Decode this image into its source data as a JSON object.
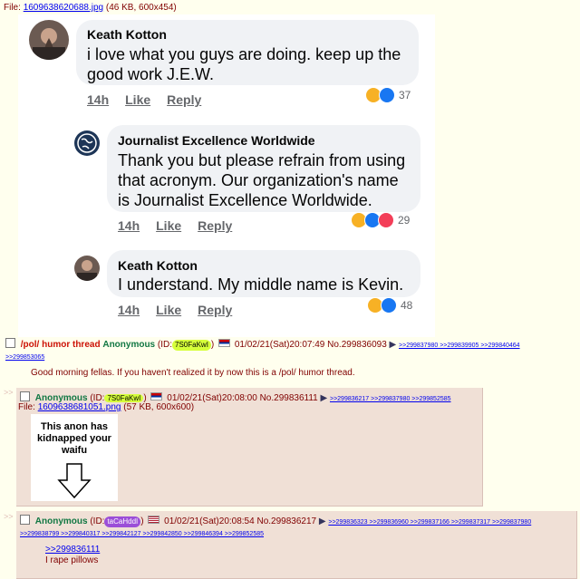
{
  "op": {
    "file_label": "File:",
    "file_name": "1609638620688.jpg",
    "file_meta": "(46 KB, 600x454)",
    "subject": "/pol/ humor thread",
    "name": "Anonymous",
    "id_prefix": "(ID:",
    "id": "7S0FaKwI",
    "id_suffix": ")",
    "date": "01/02/21(Sat)20:07:49",
    "no": "No.299836093",
    "arrow": "▶",
    "backlinks": ">>299837980 >>299839905 >>299840464",
    "backlinks2": ">>299853065",
    "message": "Good morning fellas. If you haven't realized it by now this is a /pol/ humor thread."
  },
  "fb": {
    "c1": {
      "name": "Keath Kotton",
      "text_l1": "i love what you guys are doing.  keep up the",
      "text_l2": "good work J.E.W.",
      "time": "14h",
      "like": "Like",
      "reply": "Reply",
      "count": "37"
    },
    "c2": {
      "name": "Journalist Excellence Worldwide",
      "text_l1": "Thank you but please refrain from using",
      "text_l2": "that acronym. Our organization's name",
      "text_l3": "is Journalist Excellence Worldwide.",
      "time": "14h",
      "like": "Like",
      "reply": "Reply",
      "count": "29"
    },
    "c3": {
      "name": "Keath Kotton",
      "text_l1": "I understand.  My middle name is Kevin.",
      "time": "14h",
      "like": "Like",
      "reply": "Reply",
      "count": "48"
    }
  },
  "reply1": {
    "side": ">>",
    "name": "Anonymous",
    "id_prefix": "(ID:",
    "id": "7S0FaKwI",
    "id_suffix": ")",
    "date": "01/02/21(Sat)20:08:00",
    "no": "No.299836111",
    "arrow": "▶",
    "backlinks": ">>299836217 >>299837980 >>299852585",
    "file_label": "File:",
    "file_name": "1609638681051.png",
    "file_meta": "(57 KB, 600x600)",
    "thumb_text_l1": "This anon has",
    "thumb_text_l2": "kidnapped your",
    "thumb_text_l3": "waifu"
  },
  "reply2": {
    "side": ">>",
    "name": "Anonymous",
    "id_prefix": "(ID:",
    "id": "taCaHddI",
    "id_suffix": ")",
    "date": "01/02/21(Sat)20:08:54",
    "no": "No.299836217",
    "arrow": "▶",
    "backlinks": ">>299836323 >>299836960 >>299837166 >>299837317 >>299837980",
    "backlinks2": ">>299838799 >>299840317 >>299842127 >>299842850 >>299846394 >>299852585",
    "quote": ">>299836111",
    "message": "I rape pillows"
  },
  "colors": {
    "like_blue": "#1877f2",
    "haha_yellow": "#f7b125",
    "love_red": "#f33e58",
    "id1_bg": "#d6ff3a",
    "id2_bg": "#9b4ed8"
  }
}
